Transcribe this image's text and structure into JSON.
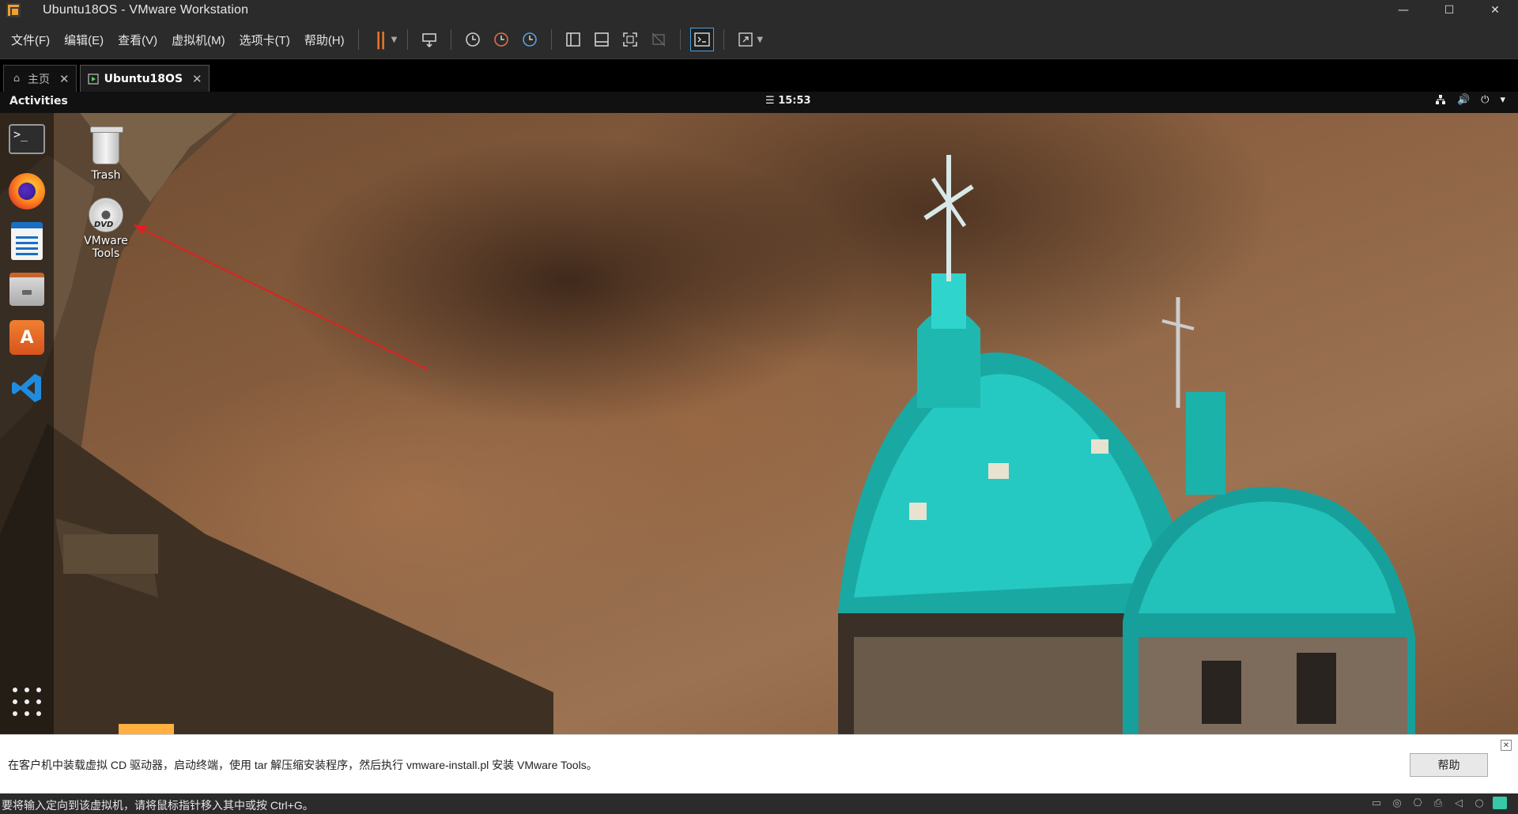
{
  "window": {
    "title": "Ubuntu18OS - VMware Workstation",
    "controls": {
      "minimize": "—",
      "maximize": "☐",
      "close": "✕"
    }
  },
  "menu": {
    "items": [
      "文件(F)",
      "编辑(E)",
      "查看(V)",
      "虚拟机(M)",
      "选项卡(T)",
      "帮助(H)"
    ]
  },
  "toolbar": {
    "icons": [
      "pause-icon",
      "send-ctrl-alt-del-icon",
      "snapshot-icon",
      "revert-snapshot-icon",
      "snapshot-manager-icon",
      "library-icon",
      "thumbnail-bar-icon",
      "fullscreen-icon",
      "unity-icon",
      "console-view-icon",
      "stretch-icon"
    ]
  },
  "tabs": [
    {
      "label": "主页",
      "icon": "home-icon",
      "close": "✕"
    },
    {
      "label": "Ubuntu18OS",
      "icon": "vm-icon",
      "close": "✕",
      "active": true
    }
  ],
  "guest": {
    "top_bar": {
      "activities": "Activities",
      "clock": "15:53",
      "tray_icons": [
        "network-icon",
        "volume-icon",
        "power-icon",
        "chevron-down-icon"
      ]
    },
    "dock": [
      "terminal",
      "firefox",
      "libreoffice-writer",
      "files",
      "ubuntu-software",
      "visual-studio-code",
      "show-applications"
    ],
    "desktop_icons": [
      {
        "label": "Trash",
        "icon": "trash-icon"
      },
      {
        "label": "VMware\nTools",
        "icon": "dvd-icon",
        "badge": "DVD"
      }
    ],
    "annotation_color": "#e02020"
  },
  "infobar": {
    "message": "在客户机中装载虚拟 CD 驱动器，启动终端，使用 tar 解压缩安装程序，然后执行 vmware-install.pl 安装 VMware Tools。",
    "help_button": "帮助",
    "close": "✕"
  },
  "statusbar": {
    "message": "要将输入定向到该虚拟机，请将鼠标指针移入其中或按 Ctrl+G。",
    "icons": [
      "hard-disk-icon",
      "cd-dvd-icon",
      "network-adapter-icon",
      "printer-icon",
      "sound-icon",
      "usb-icon",
      "message-icon"
    ]
  },
  "colors": {
    "accent_orange": "#f07828",
    "dome_teal": "#1fc8c0",
    "titlebar": "#2b2b2b"
  }
}
